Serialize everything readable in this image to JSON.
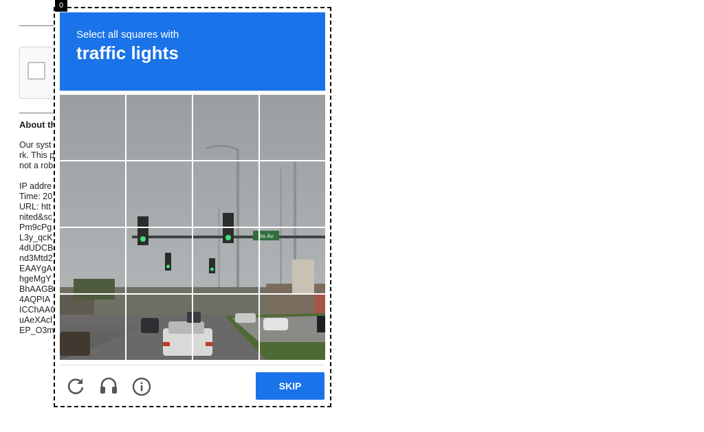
{
  "background_page": {
    "about_title": "About th",
    "lines": [
      "Our syst",
      "rk. This p",
      "not a rob",
      "",
      "IP addre",
      "Time: 20",
      "URL: htt",
      "nited&sc",
      "Pm9cPg",
      "L3y_qcK",
      "4dUDCB",
      "nd3Mtd2",
      "EAAYgA",
      "hgeMgY",
      "BhAAGB",
      "4AQPIA",
      "ICChAAC",
      "uAeXAcl",
      "EP_O3m"
    ]
  },
  "challenge": {
    "frame_index_badge": "0",
    "instruction": "Select all squares with",
    "target": "traffic lights",
    "grid_rows": 4,
    "grid_cols": 4,
    "street_sign": "llis Av",
    "skip_label": "SKIP",
    "icons": [
      "reload-icon",
      "audio-headphones-icon",
      "info-icon"
    ],
    "accent_color": "#1a73e8"
  }
}
